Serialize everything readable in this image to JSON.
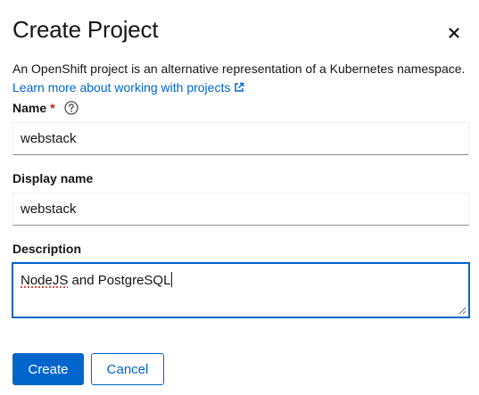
{
  "dialog": {
    "title": "Create Project",
    "description": "An OpenShift project is an alternative representation of a Kubernetes namespace.",
    "learn_more": "Learn more about working with projects"
  },
  "fields": {
    "name": {
      "label": "Name",
      "required_mark": "*",
      "value": "webstack"
    },
    "display_name": {
      "label": "Display name",
      "value": "webstack"
    },
    "description": {
      "label": "Description",
      "value_word1": "NodeJS",
      "value_rest": " and PostgreSQL"
    }
  },
  "buttons": {
    "create": "Create",
    "cancel": "Cancel"
  },
  "colors": {
    "primary": "#0066cc",
    "required": "#c9190b",
    "text": "#151515"
  },
  "icons": {
    "close": "close-icon",
    "external": "external-link-icon",
    "help": "help-icon"
  }
}
